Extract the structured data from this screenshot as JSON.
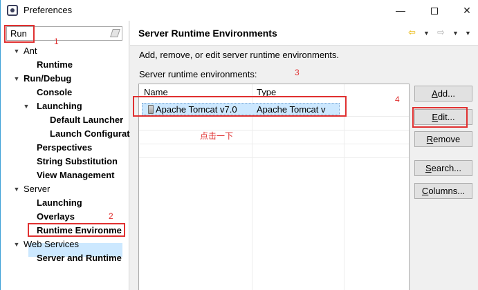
{
  "window": {
    "title": "Preferences"
  },
  "filter": {
    "value": "Run"
  },
  "tree": [
    {
      "label": "Ant",
      "bold": false,
      "indent": 0,
      "twisty": "▼"
    },
    {
      "label": "Runtime",
      "bold": true,
      "indent": 1,
      "twisty": ""
    },
    {
      "label": "Run/Debug",
      "bold": true,
      "indent": 0,
      "twisty": "▼"
    },
    {
      "label": "Console",
      "bold": true,
      "indent": 1,
      "twisty": ""
    },
    {
      "label": "Launching",
      "bold": true,
      "indent": 1,
      "twisty": "▼"
    },
    {
      "label": "Default Launcher",
      "bold": true,
      "indent": 2,
      "twisty": ""
    },
    {
      "label": "Launch Configurat",
      "bold": true,
      "indent": 2,
      "twisty": ""
    },
    {
      "label": "Perspectives",
      "bold": true,
      "indent": 1,
      "twisty": ""
    },
    {
      "label": "String Substitution",
      "bold": true,
      "indent": 1,
      "twisty": ""
    },
    {
      "label": "View Management",
      "bold": true,
      "indent": 1,
      "twisty": ""
    },
    {
      "label": "Server",
      "bold": false,
      "indent": 0,
      "twisty": "▼"
    },
    {
      "label": "Launching",
      "bold": true,
      "indent": 1,
      "twisty": ""
    },
    {
      "label": "Overlays",
      "bold": true,
      "indent": 1,
      "twisty": ""
    },
    {
      "label": "Runtime Environme",
      "bold": true,
      "indent": 1,
      "twisty": "",
      "selected": true
    },
    {
      "label": "Web Services",
      "bold": false,
      "indent": 0,
      "twisty": "▼"
    },
    {
      "label": "Server and Runtime",
      "bold": true,
      "indent": 1,
      "twisty": ""
    }
  ],
  "page": {
    "title": "Server Runtime Environments",
    "description": "Add, remove, or edit server runtime environments.",
    "list_label": "Server runtime environments:"
  },
  "table": {
    "columns": [
      "Name",
      "Type"
    ],
    "rows": [
      {
        "name": "Apache Tomcat v7.0",
        "type": "Apache Tomcat v"
      }
    ]
  },
  "buttons": {
    "add": "Add...",
    "edit": "Edit...",
    "remove": "Remove",
    "search": "Search...",
    "columns": "Columns..."
  },
  "annotations": {
    "n1": "1",
    "n2": "2",
    "n3": "3",
    "n4": "4",
    "hint": "点击一下",
    "color": "#e03030"
  },
  "icons": [
    "eclipse-app-icon",
    "clear-filter-icon",
    "back-arrow-icon",
    "forward-arrow-icon",
    "dropdown-icon",
    "jar-icon"
  ]
}
